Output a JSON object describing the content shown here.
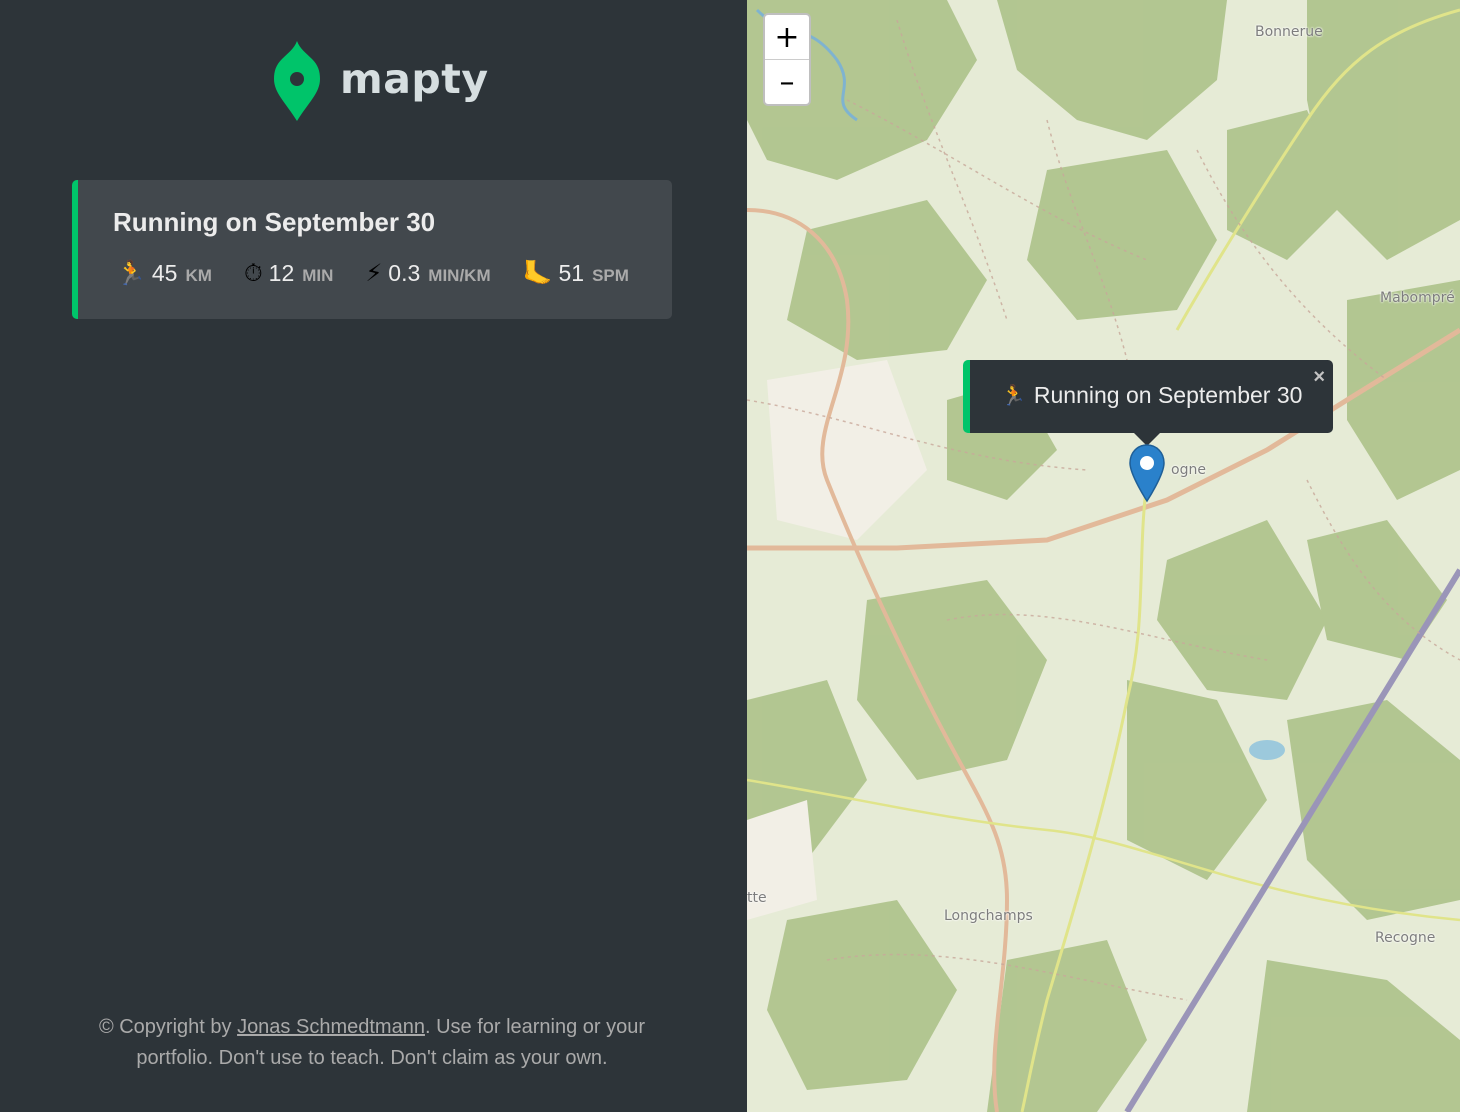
{
  "logo": {
    "text": "mapty"
  },
  "workout": {
    "title": "Running on September 30",
    "details": [
      {
        "icon": "🏃",
        "icon_name": "runner-icon",
        "value": "45",
        "unit": "KM"
      },
      {
        "icon": "⏱",
        "icon_name": "stopwatch-icon",
        "value": "12",
        "unit": "MIN"
      },
      {
        "icon": "⚡",
        "icon_name": "lightning-icon",
        "value": "0.3",
        "unit": "MIN/KM"
      },
      {
        "icon": "🦶",
        "icon_name": "foot-icon",
        "value": "51",
        "unit": "SPM"
      }
    ],
    "accent_color": "#00c46a"
  },
  "copyright": {
    "prefix": "© Copyright by ",
    "author": "Jonas Schmedtmann",
    "suffix": ". Use for learning or your portfolio. Don't use to teach. Don't claim as your own."
  },
  "map": {
    "zoom_in_label": "+",
    "zoom_out_label": "–",
    "popup": {
      "icon": "🏃",
      "text": "Running on September 30",
      "close": "×"
    },
    "labels": {
      "bonnerue": "Bonnerue",
      "mabompre": "Mabompré",
      "ogne": "ogne",
      "longchamps": "Longchamps",
      "recogne": "Recogne",
      "tte": "tte"
    }
  },
  "colors": {
    "sidebar_bg": "#2d3439",
    "card_bg": "#42484d",
    "brand_green": "#00c46a",
    "marker_blue": "#2a81cb"
  }
}
